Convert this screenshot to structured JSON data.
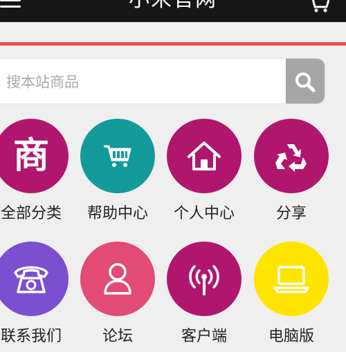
{
  "header": {
    "title": "小米官网"
  },
  "search": {
    "placeholder": "搜本站商品"
  },
  "menu": [
    {
      "label": "全部分类",
      "icon": "shang-icon",
      "color": "#b0166e"
    },
    {
      "label": "帮助中心",
      "icon": "cart-icon",
      "color": "#149a9b"
    },
    {
      "label": "个人中心",
      "icon": "home-icon",
      "color": "#b0166e"
    },
    {
      "label": "分享",
      "icon": "recycle-icon",
      "color": "#b0166e"
    },
    {
      "label": "联系我们",
      "icon": "telephone-icon",
      "color": "#7b4fcf"
    },
    {
      "label": "论坛",
      "icon": "user-icon",
      "color": "#e14b76"
    },
    {
      "label": "客户端",
      "icon": "broadcast-icon",
      "color": "#b0166e"
    },
    {
      "label": "电脑版",
      "icon": "laptop-icon",
      "color": "#ffe400"
    }
  ],
  "colors": {
    "topbar": "#161616",
    "accent_line": "#e84a4a",
    "search_button": "#a6a6a6"
  },
  "icon_glyphs": {
    "shang": "商"
  }
}
